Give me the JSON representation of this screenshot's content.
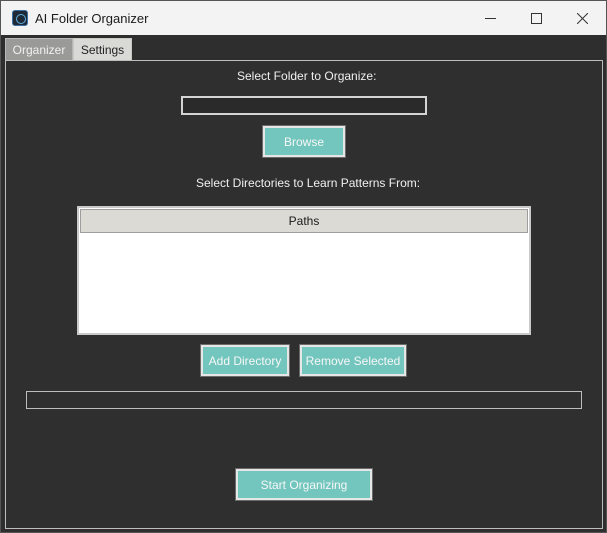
{
  "window": {
    "title": "AI Folder Organizer",
    "icon": "app-icon"
  },
  "tabs": [
    {
      "label": "Organizer",
      "selected": true
    },
    {
      "label": "Settings",
      "selected": false
    }
  ],
  "organizer": {
    "select_folder_label": "Select Folder to Organize:",
    "folder_path_value": "",
    "browse_label": "Browse",
    "learn_label": "Select Directories to Learn Patterns From:",
    "paths_table": {
      "columns": [
        "Paths"
      ],
      "rows": []
    },
    "add_directory_label": "Add Directory",
    "remove_selected_label": "Remove Selected",
    "progress_fraction": 0,
    "start_label": "Start Organizing"
  },
  "colors": {
    "accent": "#72c6bd",
    "background": "#2f2f2f"
  }
}
